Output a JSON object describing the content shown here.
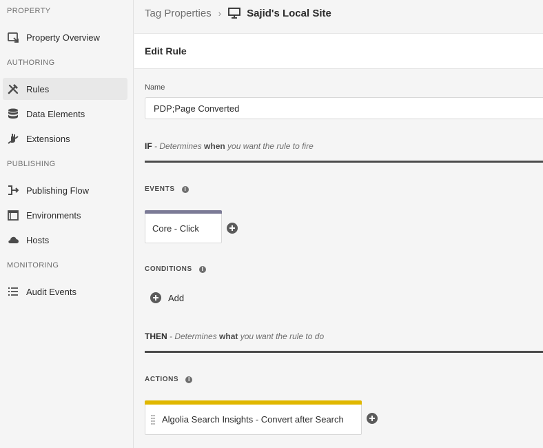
{
  "sidebar": {
    "sections": [
      {
        "heading": "PROPERTY",
        "items": [
          {
            "label": "Property Overview",
            "icon": "property-overview-icon"
          }
        ]
      },
      {
        "heading": "AUTHORING",
        "items": [
          {
            "label": "Rules",
            "icon": "rules-icon",
            "active": true
          },
          {
            "label": "Data Elements",
            "icon": "data-elements-icon"
          },
          {
            "label": "Extensions",
            "icon": "extensions-icon"
          }
        ]
      },
      {
        "heading": "PUBLISHING",
        "items": [
          {
            "label": "Publishing Flow",
            "icon": "publishing-flow-icon"
          },
          {
            "label": "Environments",
            "icon": "environments-icon"
          },
          {
            "label": "Hosts",
            "icon": "hosts-icon"
          }
        ]
      },
      {
        "heading": "MONITORING",
        "items": [
          {
            "label": "Audit Events",
            "icon": "audit-events-icon"
          }
        ]
      }
    ]
  },
  "breadcrumb": {
    "parent": "Tag Properties",
    "separator": "›",
    "current": "Sajid's Local Site",
    "current_icon": "monitor-icon"
  },
  "editor": {
    "title": "Edit Rule",
    "name_label": "Name",
    "name_value": "PDP;Page Converted"
  },
  "if_clause": {
    "keyword": "IF",
    "text_before": " - Determines ",
    "emphasis": "when",
    "text_after": " you want the rule to fire"
  },
  "events": {
    "heading": "EVENTS",
    "info_icon": "info-icon",
    "items": [
      {
        "label": "Core - Click",
        "bar_color": "#7b7a96"
      }
    ]
  },
  "conditions": {
    "heading": "CONDITIONS",
    "info_icon": "info-icon",
    "add_label": "Add"
  },
  "then_clause": {
    "keyword": "THEN",
    "text_before": " - Determines ",
    "emphasis": "what",
    "text_after": " you want the rule to do"
  },
  "actions": {
    "heading": "ACTIONS",
    "info_icon": "info-icon",
    "items": [
      {
        "label": "Algolia Search Insights - Convert after Search",
        "bar_color": "#e0b700"
      }
    ]
  },
  "colors": {
    "sidebar_bg": "#f5f5f5",
    "active_item_bg": "#e8e8e8",
    "divider": "#4b4b4b",
    "event_bar": "#7b7a96",
    "action_bar": "#e0b700"
  }
}
